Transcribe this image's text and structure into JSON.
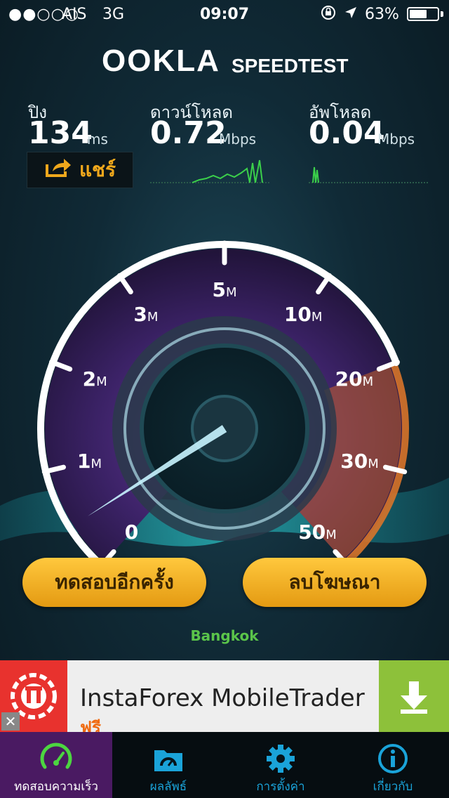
{
  "status": {
    "signal": "●●○○○",
    "carrier": "AIS",
    "network": "3G",
    "time": "09:07",
    "battery": "63%",
    "battery_level": 0.63
  },
  "header": {
    "brand": "OOKLA",
    "product": "SPEEDTEST"
  },
  "metrics": {
    "ping": {
      "label": "ปิง",
      "value": "134",
      "unit": "ms"
    },
    "download": {
      "label": "ดาวน์โหลด",
      "value": "0.72",
      "unit": "Mbps"
    },
    "upload": {
      "label": "อัพโหลด",
      "value": "0.04",
      "unit": "Mbps"
    }
  },
  "share_label": "แชร์",
  "gauge": {
    "ticks": [
      {
        "num": "0",
        "unit": ""
      },
      {
        "num": "1",
        "unit": "M"
      },
      {
        "num": "2",
        "unit": "M"
      },
      {
        "num": "3",
        "unit": "M"
      },
      {
        "num": "5",
        "unit": "M"
      },
      {
        "num": "10",
        "unit": "M"
      },
      {
        "num": "20",
        "unit": "M"
      },
      {
        "num": "30",
        "unit": "M"
      },
      {
        "num": "50",
        "unit": "M"
      }
    ],
    "needle_value_mbps": 0.04
  },
  "buttons": {
    "retest": "ทดสอบอีกครั้ง",
    "remove_ads": "ลบโฆษณา"
  },
  "location": "Bangkok",
  "ad": {
    "title": "InstaForex MobileTrader",
    "subtitle": "ฟรี"
  },
  "tabs": [
    {
      "label": "ทดสอบความเร็ว",
      "icon": "speedometer-icon",
      "active": true
    },
    {
      "label": "ผลลัพธ์",
      "icon": "results-folder-icon",
      "active": false
    },
    {
      "label": "การตั้งค่า",
      "icon": "gear-icon",
      "active": false
    },
    {
      "label": "เกี่ยวกับ",
      "icon": "info-icon",
      "active": false
    }
  ],
  "colors": {
    "accent": "#1aa3d9",
    "button": "#f0a81c",
    "active_tab": "#4a1a62",
    "green": "#5ac44a"
  }
}
